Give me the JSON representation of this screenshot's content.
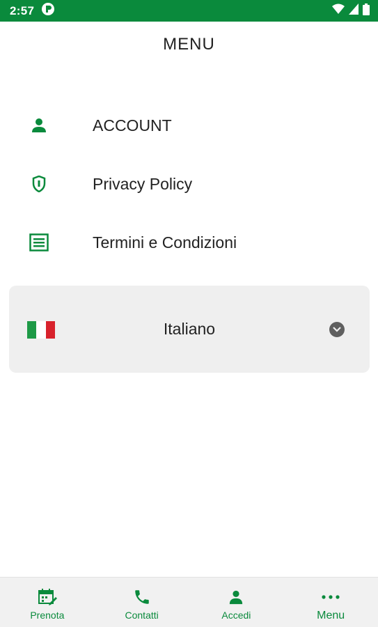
{
  "status_bar": {
    "time": "2:57"
  },
  "page": {
    "title": "MENU"
  },
  "menu": {
    "items": [
      {
        "label": "ACCOUNT",
        "icon": "person-icon"
      },
      {
        "label": "Privacy Policy",
        "icon": "shield-icon"
      },
      {
        "label": "Termini e Condizioni",
        "icon": "document-list-icon"
      }
    ]
  },
  "language": {
    "selected": "Italiano",
    "flag": "italy-flag-icon"
  },
  "bottom_nav": {
    "items": [
      {
        "label": "Prenota",
        "icon": "calendar-edit-icon"
      },
      {
        "label": "Contatti",
        "icon": "phone-icon"
      },
      {
        "label": "Accedi",
        "icon": "person-icon"
      },
      {
        "label": "Menu",
        "icon": "more-dots-icon"
      }
    ]
  },
  "colors": {
    "accent": "#0a8a3c",
    "flag_green": "#1e9a47",
    "flag_red": "#d8222c",
    "card_bg": "#efefef"
  }
}
